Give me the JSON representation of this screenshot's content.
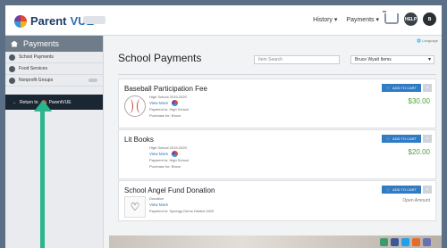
{
  "app": {
    "logo_text_a": "Parent",
    "logo_text_b": "VUE"
  },
  "nav": {
    "history_label": "History",
    "payments_label": "Payments",
    "help_label": "HELP",
    "user_label": "B"
  },
  "sidebar": {
    "header_label": "Payments",
    "items": [
      {
        "label": "School Payments"
      },
      {
        "label": "Food Services"
      },
      {
        "label": "Nonprofit Groups"
      }
    ],
    "return_label": "Return to",
    "return_app": "ParentVUE"
  },
  "main": {
    "language_label": "Language",
    "title": "School Payments",
    "search_placeholder": "Item Search",
    "student_select_value": "Bruce Wyatt Items"
  },
  "cards": [
    {
      "title": "Baseball Participation Fee",
      "school": "High School 2019-2020",
      "view_more": "View More",
      "payment_to": "Payment to: High School",
      "purchase_for": "Purchase for: Bruce",
      "add_label": "ADD TO CART",
      "amount": "$30.00"
    },
    {
      "title": "Lit Books",
      "school": "High School 2019-2020",
      "view_more": "View More",
      "payment_to": "Payment to: High School",
      "purchase_for": "Purchase for: Bruce",
      "add_label": "ADD TO CART",
      "amount": "$20.00"
    },
    {
      "title": "School Angel Fund Donation",
      "school": "Donation",
      "view_more": "View More",
      "payment_to": "Payment to: Synergy Demo District 2020",
      "add_label": "ADD TO CART",
      "amount": "Open Amount"
    }
  ],
  "colors": {
    "accent": "#2f7bc4",
    "price": "#4fa33a",
    "arrow": "#2ab58d"
  }
}
